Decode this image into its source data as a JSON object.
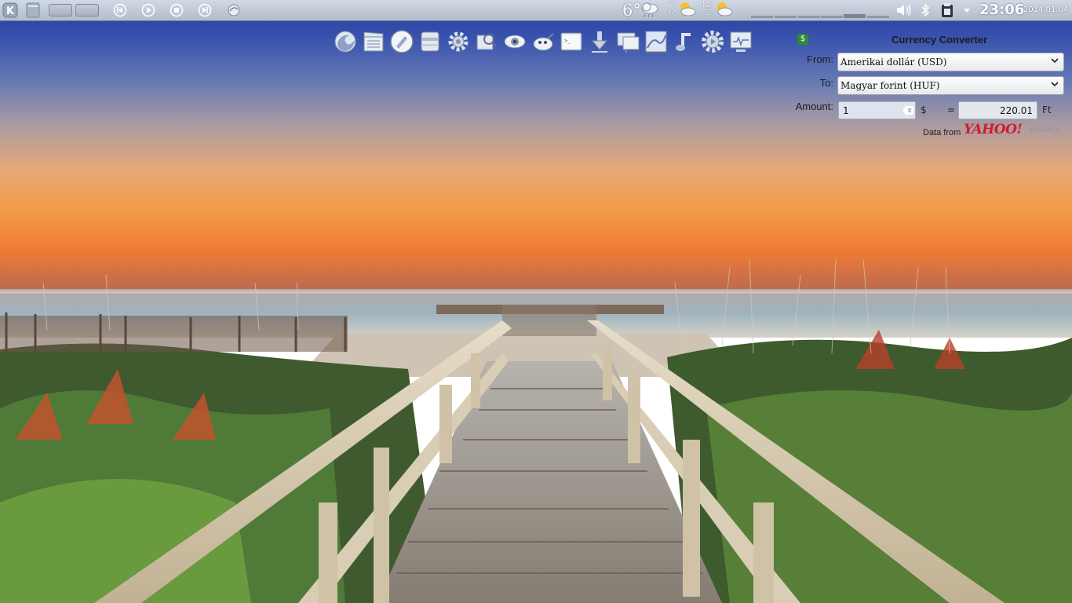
{
  "panel": {
    "weather": {
      "current_temp": "6°",
      "forecast": [
        {
          "high": "7°",
          "low": "6°"
        },
        {
          "high": "12°",
          "low": "3°"
        }
      ]
    },
    "clock": {
      "time": "23:06",
      "date": "2014.01.04"
    },
    "icons": [
      "kde-menu-icon",
      "show-desktop-icon",
      "previous-track-icon",
      "play-icon",
      "stop-icon",
      "next-track-icon",
      "activity-icon",
      "volume-icon",
      "bluetooth-icon",
      "clipboard-icon",
      "chevron-down-icon"
    ]
  },
  "launcher": {
    "icons": [
      "firefox-icon",
      "video-editor-icon",
      "web-browser-icon",
      "file-manager-icon",
      "settings-gear-icon",
      "image-viewer-icon",
      "eye-icon",
      "gimp-icon",
      "terminal-icon",
      "download-icon",
      "network-monitor-icon",
      "office-chart-icon",
      "music-icon",
      "system-settings-icon",
      "system-monitor-icon"
    ]
  },
  "currency_converter": {
    "title": "Currency Converter",
    "from_label": "From:",
    "to_label": "To:",
    "amount_label": "Amount:",
    "from_currency": "Amerikai dollár (USD)",
    "to_currency": "Magyar forint (HUF)",
    "amount": "1",
    "from_symbol": "$",
    "equals": "=",
    "result": "220.01",
    "to_symbol": "Ft",
    "data_from": "Data from",
    "provider": "YAHOO!",
    "provider_suffix": "FINANCE"
  },
  "colors": {
    "panel_top": "#d2d9e4",
    "sky_top": "#2e48a6",
    "horizon": "#f6a24f",
    "yahoo_red": "#d21b2f"
  }
}
